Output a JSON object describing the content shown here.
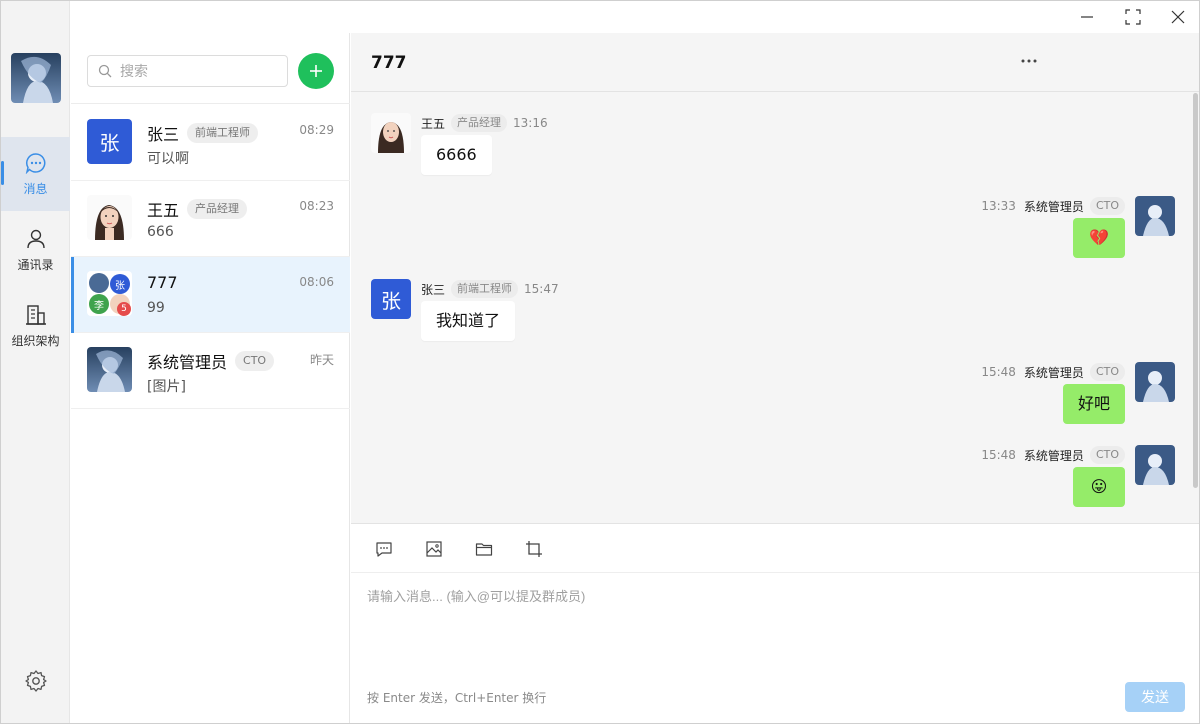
{
  "window": {
    "controls": [
      "minimize",
      "maximize",
      "close"
    ]
  },
  "rail": {
    "items": [
      {
        "label": "消息",
        "icon": "chat-bubble-icon",
        "active": true
      },
      {
        "label": "通讯录",
        "icon": "person-icon",
        "active": false
      },
      {
        "label": "组织架构",
        "icon": "building-icon",
        "active": false
      }
    ],
    "settings_icon": "gear-icon",
    "accent": "#3a8ee6"
  },
  "search": {
    "placeholder": "搜索"
  },
  "conversations": [
    {
      "name": "张三",
      "tag": "前端工程师",
      "time": "08:29",
      "preview": "可以啊",
      "avatar_letter": "张",
      "avatar_color": "#2f5bd6"
    },
    {
      "name": "王五",
      "tag": "产品经理",
      "time": "08:23",
      "preview": "666",
      "avatar_letter": "",
      "avatar_color": "#f1d6c7"
    },
    {
      "name": "777",
      "tag": "",
      "time": "08:06",
      "preview": "99",
      "avatar_letter": "",
      "group_badges": [
        "张",
        "李",
        "5"
      ]
    },
    {
      "name": "系统管理员",
      "tag": "CTO",
      "time": "昨天",
      "preview": "[图片]",
      "avatar_letter": "",
      "avatar_color": "#3b5a86"
    }
  ],
  "chat": {
    "title": "777",
    "messages": [
      {
        "side": "left",
        "name": "王五",
        "tag": "产品经理",
        "time": "13:16",
        "text": "6666"
      },
      {
        "side": "right",
        "name": "系统管理员",
        "tag": "CTO",
        "time": "13:33",
        "text": "💔"
      },
      {
        "side": "left",
        "name": "张三",
        "tag": "前端工程师",
        "time": "15:47",
        "text": "我知道了",
        "avatar_letter": "张"
      },
      {
        "side": "right",
        "name": "系统管理员",
        "tag": "CTO",
        "time": "15:48",
        "text": "好吧"
      },
      {
        "side": "right",
        "name": "系统管理员",
        "tag": "CTO",
        "time": "15:48",
        "text": "😛"
      }
    ]
  },
  "compose": {
    "tools": [
      "message-icon",
      "image-icon",
      "folder-icon",
      "crop-icon"
    ],
    "placeholder": "请输入消息... (输入@可以提及群成员)",
    "hint": "按 Enter 发送，Ctrl+Enter 换行",
    "send_label": "发送",
    "send_color": "#a6d1f7"
  }
}
